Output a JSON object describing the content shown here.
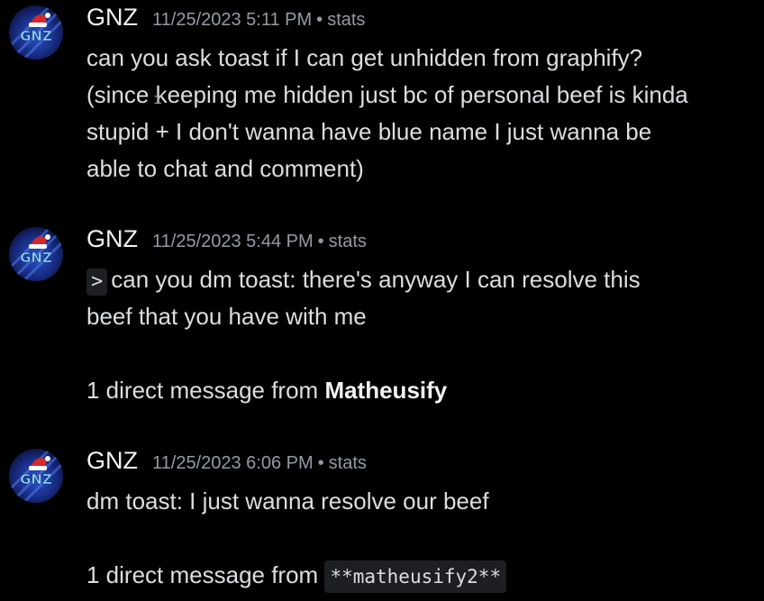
{
  "messages": [
    {
      "username": "GNZ",
      "timestamp": "11/25/2023 5:11 PM",
      "separator": "•",
      "stats_label": "stats",
      "lines": [
        "can you ask toast if I can get unhidden from graphify?",
        "(since keeping me hidden just bc of personal beef is kinda",
        "stupid + I don't wanna have blue name I just wanna be",
        "able to chat and comment)"
      ]
    },
    {
      "username": "GNZ",
      "timestamp": "11/25/2023 5:44 PM",
      "separator": "•",
      "stats_label": "stats",
      "quote_marker": ">",
      "lines": [
        "can you dm toast: there's anyway I can resolve this",
        "beef that you have with me"
      ],
      "dm_prefix": "1 direct message from ",
      "dm_name": "Matheusify"
    },
    {
      "username": "GNZ",
      "timestamp": "11/25/2023 6:06 PM",
      "separator": "•",
      "stats_label": "stats",
      "lines": [
        "dm toast: I just wanna resolve our beef"
      ],
      "dm_prefix": "1 direct message from ",
      "dm_code": "**matheusify2**"
    }
  ],
  "avatar_icon": "santa-hat-gnz-logo-icon",
  "colors": {
    "background": "#000000",
    "text": "#dbdee1",
    "username": "#f2f3f5",
    "muted": "#949ba4",
    "code_bg": "#1e1f22",
    "avatar_blue": "#2b55c8",
    "santa_red": "#d62828"
  }
}
